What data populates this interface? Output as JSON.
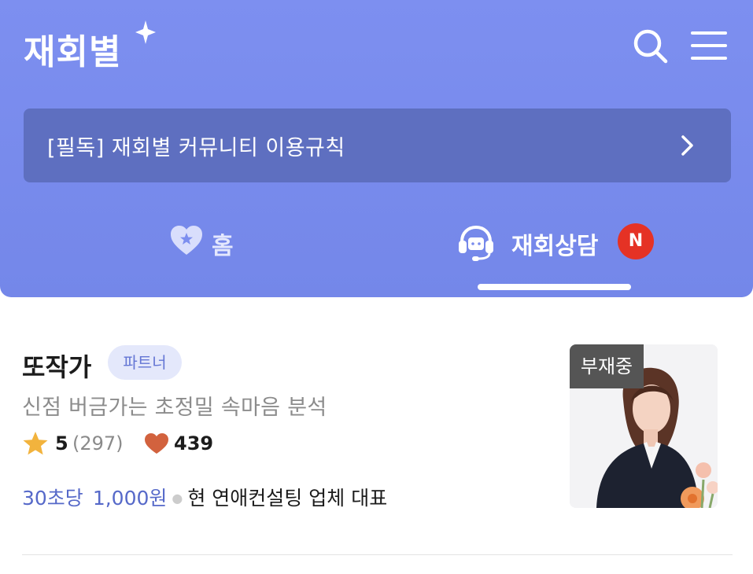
{
  "app": {
    "logo_text": "재회별"
  },
  "header": {
    "search_icon": "search-icon",
    "menu_icon": "hamburger-menu-icon",
    "background_color": "#7b8def"
  },
  "notice": {
    "text": "[필독] 재회별 커뮤니티 이용규칙"
  },
  "tabs": [
    {
      "label": "홈",
      "icon": "heart-star-icon",
      "active": false
    },
    {
      "label": "재회상담",
      "icon": "headset-icon",
      "active": true,
      "badge": "N"
    }
  ],
  "counselor": {
    "name": "또작가",
    "badge": "파트너",
    "tagline": "신점 버금가는 초정밀 속마음 분석",
    "rating": "5",
    "review_count": "(297)",
    "likes": "439",
    "unit_time": "30초당",
    "price": "1,000원",
    "position": "현 연애컨설팅 업체 대표",
    "status": "부재중"
  },
  "colors": {
    "accent": "#5669c9",
    "notice_bg": "#5e6fc0",
    "new_badge": "#e53225",
    "star": "#f2b33d",
    "heart": "#d2623e"
  }
}
